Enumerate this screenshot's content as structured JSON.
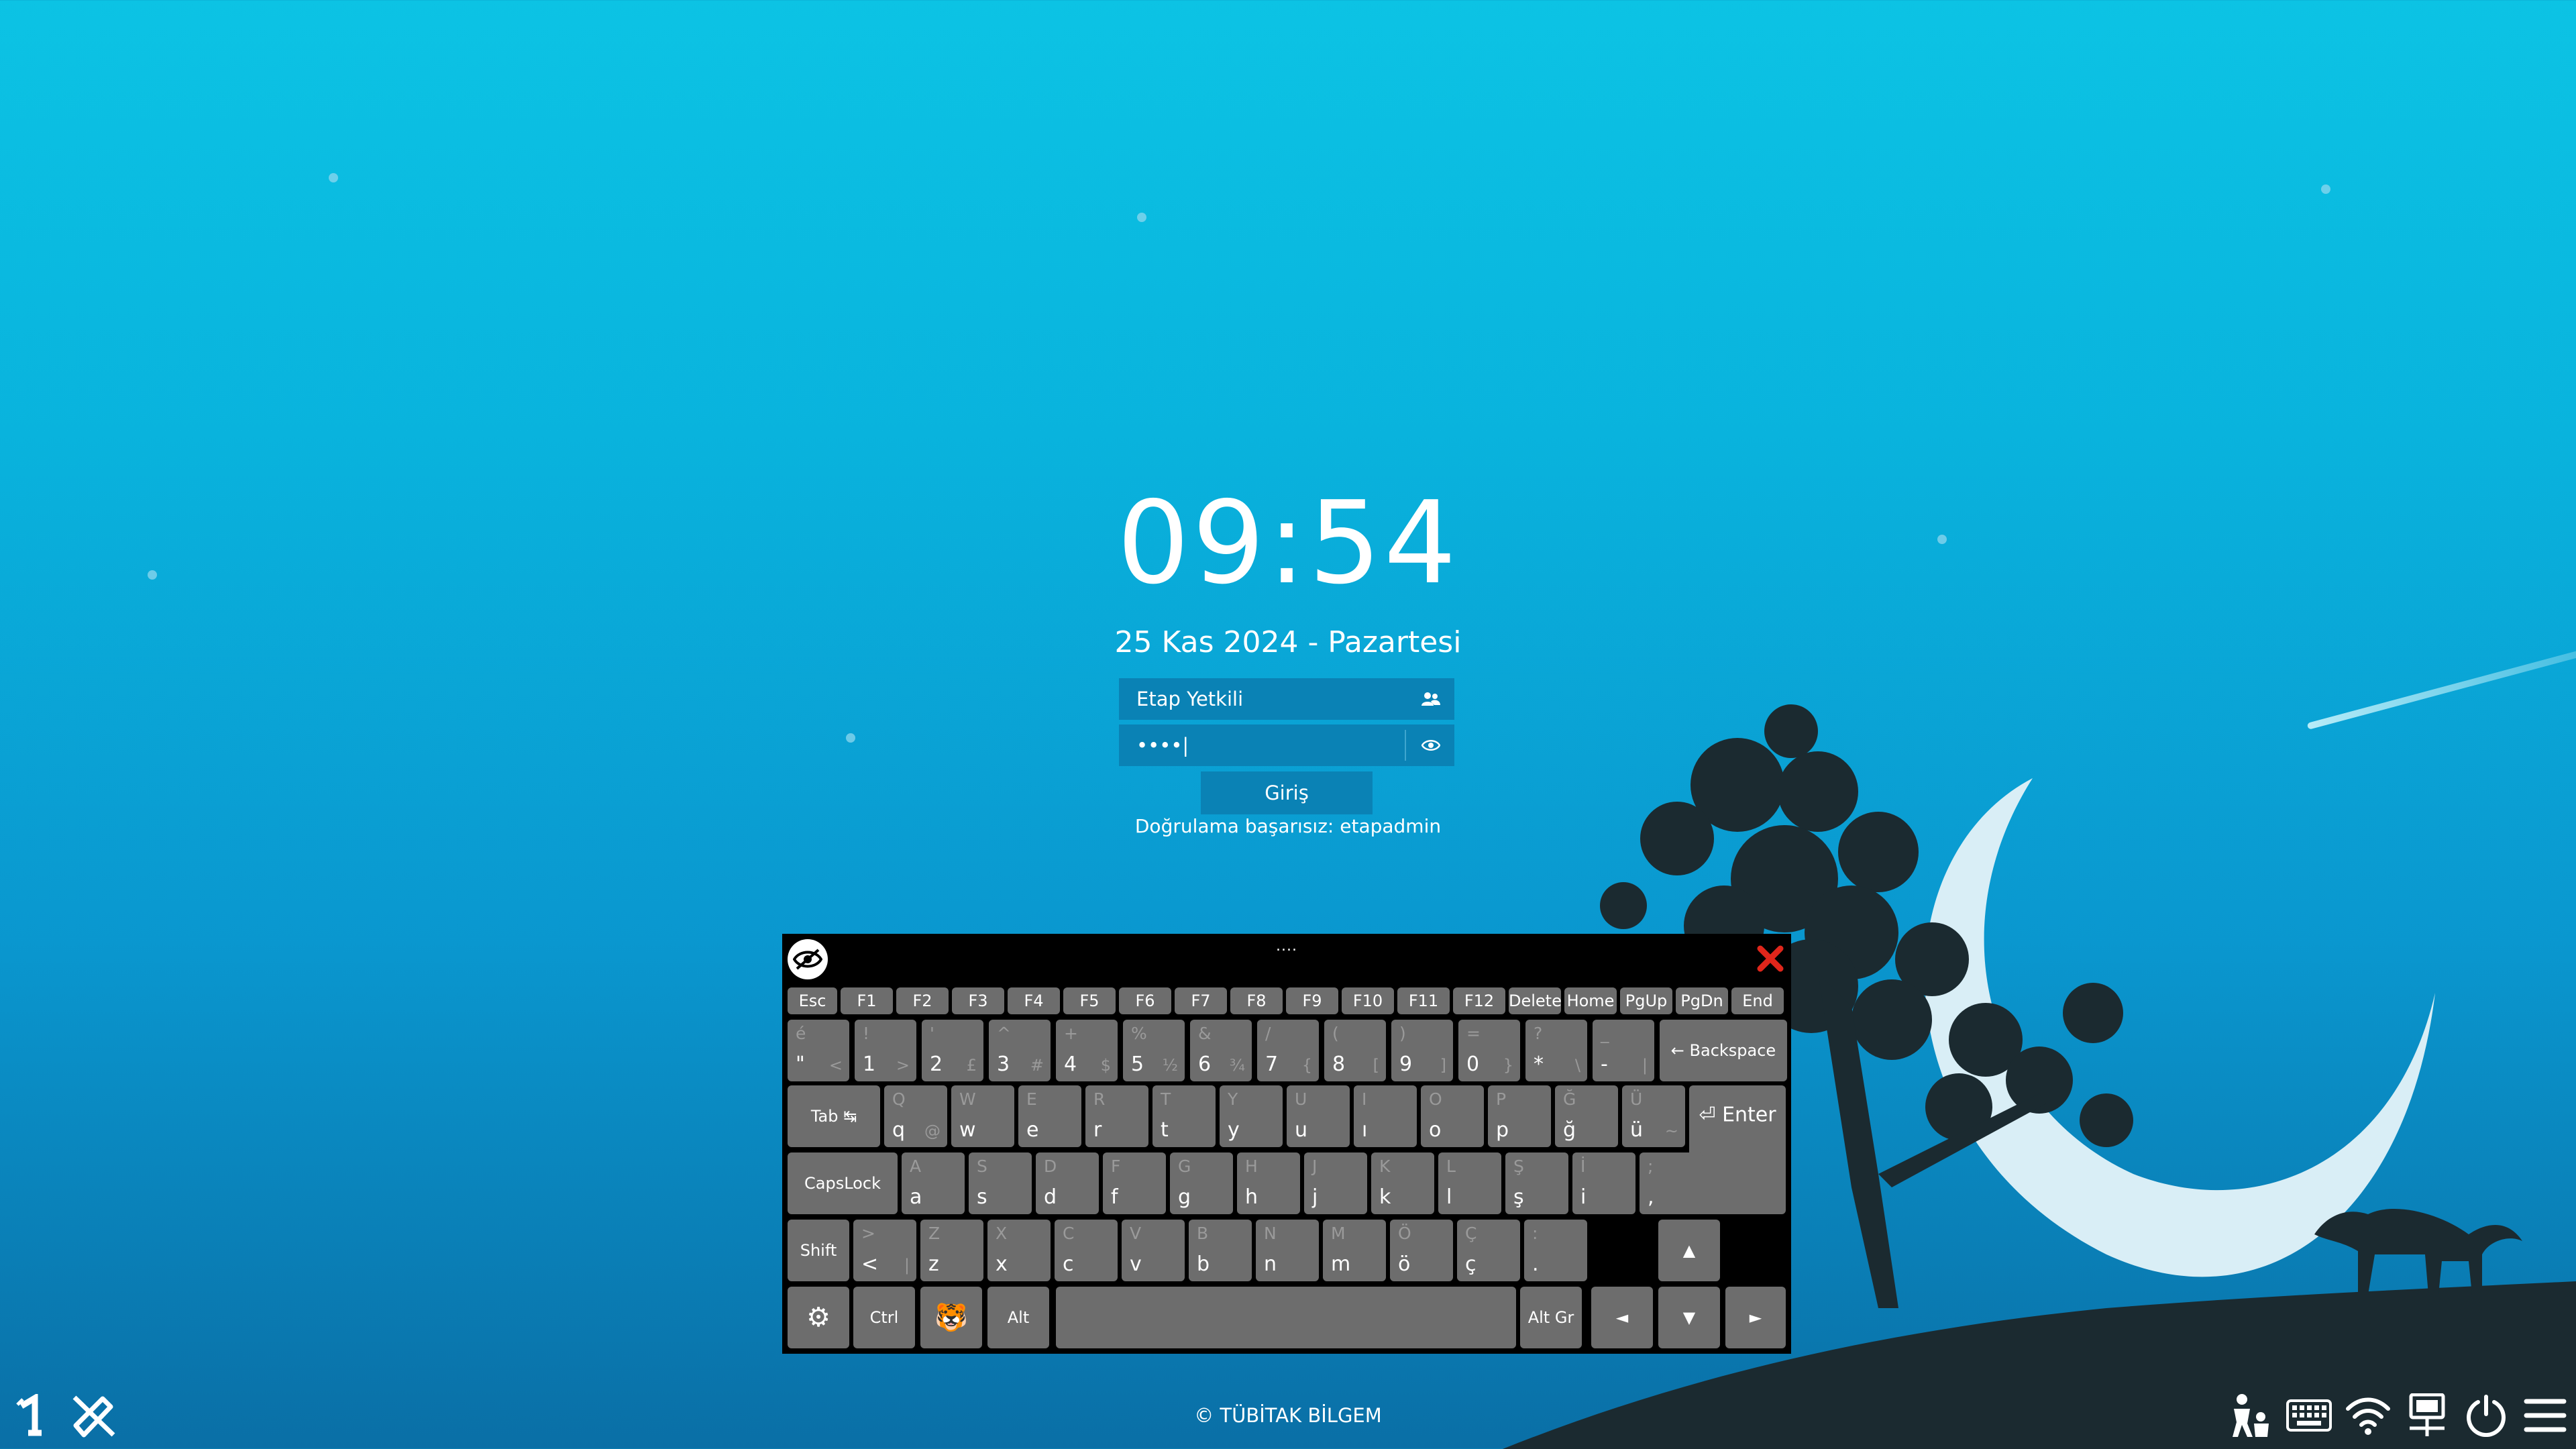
{
  "clock": {
    "time": "09:54",
    "date": "25 Kas 2024 - Pazartesi"
  },
  "login": {
    "username": "Etap Yetkili",
    "password_masked": "••••|",
    "submit_label": "Giriş",
    "error_message": "Doğrulama başarısız: etapadmin"
  },
  "keyboard": {
    "handle_label": "....",
    "rows": [
      [
        {
          "label": "Esc"
        },
        {
          "label": "F1"
        },
        {
          "label": "F2"
        },
        {
          "label": "F3"
        },
        {
          "label": "F4"
        },
        {
          "label": "F5"
        },
        {
          "label": "F6"
        },
        {
          "label": "F7"
        },
        {
          "label": "F8"
        },
        {
          "label": "F9"
        },
        {
          "label": "F10"
        },
        {
          "label": "F11"
        },
        {
          "label": "F12"
        },
        {
          "label": "Delete"
        },
        {
          "label": "Home"
        },
        {
          "label": "PgUp"
        },
        {
          "label": "PgDn"
        },
        {
          "label": "End"
        }
      ],
      [
        {
          "main": "\"",
          "shift": "é",
          "alt": "<"
        },
        {
          "main": "1",
          "shift": "!",
          "alt": ">"
        },
        {
          "main": "2",
          "shift": "'",
          "alt": "£"
        },
        {
          "main": "3",
          "shift": "^",
          "alt": "#"
        },
        {
          "main": "4",
          "shift": "+",
          "alt": "$"
        },
        {
          "main": "5",
          "shift": "%",
          "alt": "½"
        },
        {
          "main": "6",
          "shift": "&",
          "alt": "¾"
        },
        {
          "main": "7",
          "shift": "/",
          "alt": "{"
        },
        {
          "main": "8",
          "shift": "(",
          "alt": "["
        },
        {
          "main": "9",
          "shift": ")",
          "alt": "]"
        },
        {
          "main": "0",
          "shift": "=",
          "alt": "}"
        },
        {
          "main": "*",
          "shift": "?",
          "alt": "\\"
        },
        {
          "main": "-",
          "shift": "_",
          "alt": "|"
        },
        {
          "label": "← Backspace"
        }
      ],
      [
        {
          "label": "Tab ↹"
        },
        {
          "main": "q",
          "shift": "Q",
          "alt": "@"
        },
        {
          "main": "w",
          "shift": "W"
        },
        {
          "main": "e",
          "shift": "E"
        },
        {
          "main": "r",
          "shift": "R"
        },
        {
          "main": "t",
          "shift": "T"
        },
        {
          "main": "y",
          "shift": "Y"
        },
        {
          "main": "u",
          "shift": "U"
        },
        {
          "main": "ı",
          "shift": "I"
        },
        {
          "main": "o",
          "shift": "O"
        },
        {
          "main": "p",
          "shift": "P"
        },
        {
          "main": "ğ",
          "shift": "Ğ"
        },
        {
          "main": "ü",
          "shift": "Ü",
          "alt": "~"
        },
        {
          "label": "⏎ Enter"
        }
      ],
      [
        {
          "label": "CapsLock"
        },
        {
          "main": "a",
          "shift": "A"
        },
        {
          "main": "s",
          "shift": "S"
        },
        {
          "main": "d",
          "shift": "D"
        },
        {
          "main": "f",
          "shift": "F"
        },
        {
          "main": "g",
          "shift": "G"
        },
        {
          "main": "h",
          "shift": "H"
        },
        {
          "main": "j",
          "shift": "J"
        },
        {
          "main": "k",
          "shift": "K"
        },
        {
          "main": "l",
          "shift": "L"
        },
        {
          "main": "ş",
          "shift": "Ş"
        },
        {
          "main": "i",
          "shift": "İ"
        },
        {
          "main": ",",
          "shift": ";"
        }
      ],
      [
        {
          "label": "Shift"
        },
        {
          "main": "<",
          "shift": ">",
          "alt": "|"
        },
        {
          "main": "z",
          "shift": "Z"
        },
        {
          "main": "x",
          "shift": "X"
        },
        {
          "main": "c",
          "shift": "C"
        },
        {
          "main": "v",
          "shift": "V"
        },
        {
          "main": "b",
          "shift": "B"
        },
        {
          "main": "n",
          "shift": "N"
        },
        {
          "main": "m",
          "shift": "M"
        },
        {
          "main": "ö",
          "shift": "Ö"
        },
        {
          "main": "ç",
          "shift": "Ç"
        },
        {
          "main": ".",
          "shift": ":"
        },
        {
          "label": "▲"
        }
      ],
      [
        {
          "label": "⚙"
        },
        {
          "label": "Ctrl"
        },
        {
          "label": "🐯"
        },
        {
          "label": "Alt"
        },
        {
          "label": ""
        },
        {
          "label": "Alt Gr"
        },
        {
          "label": "◄"
        },
        {
          "label": "▼"
        },
        {
          "label": "►"
        }
      ]
    ]
  },
  "footer": {
    "copyright": "© TÜBİTAK BİLGEM"
  },
  "taskbar": {
    "left_icons": [
      "workspace-1-icon",
      "pardus-logo-icon"
    ],
    "right_icons": [
      "accessibility-icon",
      "keyboard-icon",
      "wifi-icon",
      "network-icon",
      "power-icon",
      "menu-icon"
    ]
  }
}
